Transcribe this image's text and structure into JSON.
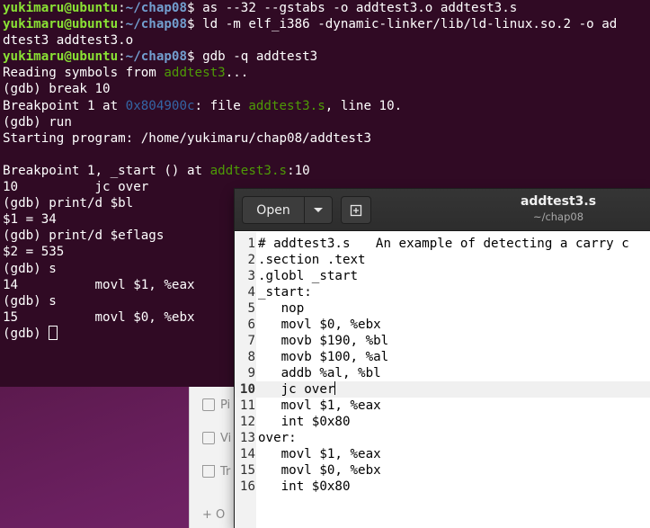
{
  "terminal": {
    "prompt_user": "yukimaru@ubuntu",
    "prompt_path": "~/chap08",
    "lines": [
      {
        "cmd": "as --32 --gstabs -o addtest3.o addtest3.s"
      },
      {
        "cmd": "ld -m elf_i386 -dynamic-linker/lib/ld-linux.so.2 -o ad"
      },
      {
        "text": "dtest3 addtest3.o"
      },
      {
        "cmd": "gdb -q addtest3"
      },
      {
        "pre": "Reading symbols from ",
        "file": "addtest3",
        "post": "..."
      },
      {
        "text": "(gdb) break 10"
      },
      {
        "pre": "Breakpoint 1 at ",
        "addr": "0x804900c",
        "mid": ": file ",
        "file": "addtest3.s",
        "post": ", line 10."
      },
      {
        "text": "(gdb) run"
      },
      {
        "text": "Starting program: /home/yukimaru/chap08/addtest3"
      },
      {
        "text": ""
      },
      {
        "pre": "Breakpoint 1, ",
        "func": "_start",
        "mid": " () at ",
        "file": "addtest3.s",
        "post": ":10"
      },
      {
        "text": "10          jc over"
      },
      {
        "text": "(gdb) print/d $bl"
      },
      {
        "text": "$1 = 34"
      },
      {
        "text": "(gdb) print/d $eflags"
      },
      {
        "text": "$2 = 535"
      },
      {
        "text": "(gdb) s"
      },
      {
        "text": "14          movl $1, %eax"
      },
      {
        "text": "(gdb) s"
      },
      {
        "text": "15          movl $0, %ebx"
      },
      {
        "text": "(gdb) "
      }
    ]
  },
  "file_chooser": {
    "items": [
      {
        "icon": "pictures-icon",
        "label": "Pi"
      },
      {
        "icon": "videos-icon",
        "label": "Vi"
      },
      {
        "icon": "trash-icon",
        "label": "Tr"
      },
      {
        "icon": "plus-icon",
        "label": "+ O"
      }
    ]
  },
  "gedit": {
    "open_label": "Open",
    "title": "addtest3.s",
    "subtitle": "~/chap08",
    "current_line": 10,
    "code": [
      "# addtest3.s  An example of detecting a carry c",
      ".section .text",
      ".globl _start",
      "_start:",
      "   nop",
      "   movl $0, %ebx",
      "   movb $190, %bl",
      "   movb $100, %al",
      "   addb %al, %bl",
      "   jc over",
      "   movl $1, %eax",
      "   int $0x80",
      "over:",
      "   movl $1, %eax",
      "   movl $0, %ebx",
      "   int $0x80"
    ]
  }
}
